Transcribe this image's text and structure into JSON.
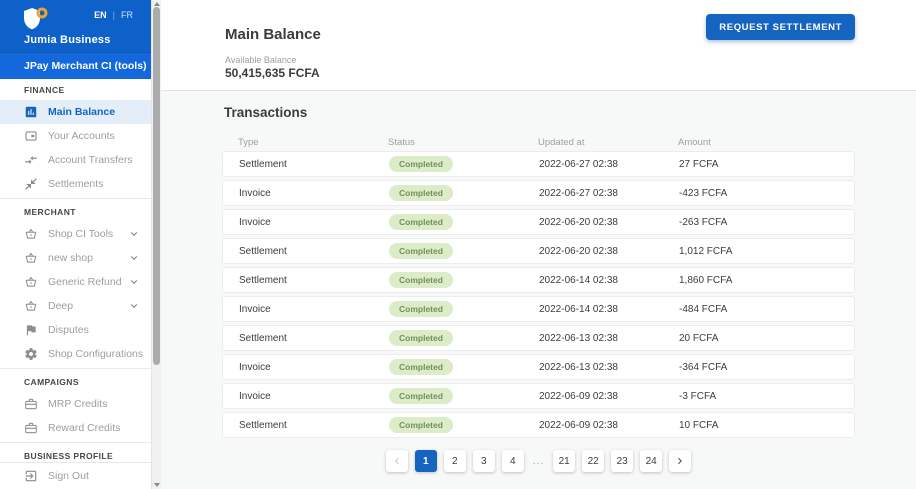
{
  "colors": {
    "accent": "#1565c0",
    "sidebar_header_blue": "#0d61c9",
    "sidebar_app_row_blue": "#1368dc",
    "selected_item_bg": "#e4eef9",
    "content_bg": "#f7f8f8",
    "badge_bg": "#dcebc8",
    "badge_text": "#71905a",
    "logo_ring_orange": "#f0a22e"
  },
  "icons": {
    "logo": "shield-with-orange-ring",
    "main_balance": "bar-chart-square",
    "your_accounts": "wallet",
    "account_transfers": "compare-arrows",
    "settlements": "collapse-diagonal-arrows",
    "merchant_item": "shopping-basket",
    "disputes": "flag",
    "shop_configurations": "gear",
    "campaigns_item": "briefcase",
    "sign_out": "exit-to-app",
    "expand": "chevron-down",
    "pager_prev": "chevron-left",
    "pager_next": "chevron-right"
  },
  "sidebar": {
    "brand": "Jumia Business",
    "lang_en": "EN",
    "lang_sep": "|",
    "lang_fr": "FR",
    "app_name": "JPay Merchant CI (tools)",
    "sign_out": "Sign Out",
    "sections": [
      {
        "title": "FINANCE",
        "items": [
          {
            "label": "Main Balance",
            "selected": true
          },
          {
            "label": "Your Accounts"
          },
          {
            "label": "Account Transfers"
          },
          {
            "label": "Settlements"
          }
        ]
      },
      {
        "title": "MERCHANT",
        "items": [
          {
            "label": "Shop CI Tools",
            "expandable": true
          },
          {
            "label": "new shop",
            "expandable": true
          },
          {
            "label": "Generic Refund",
            "expandable": true
          },
          {
            "label": "Deep",
            "expandable": true
          },
          {
            "label": "Disputes"
          },
          {
            "label": "Shop Configurations"
          }
        ]
      },
      {
        "title": "CAMPAIGNS",
        "items": [
          {
            "label": "MRP Credits"
          },
          {
            "label": "Reward Credits"
          }
        ]
      },
      {
        "title": "BUSINESS PROFILE",
        "items": []
      }
    ]
  },
  "header": {
    "title": "Main Balance",
    "request_button": "REQUEST SETTLEMENT"
  },
  "balance": {
    "label": "Available Balance",
    "value": "50,415,635 FCFA"
  },
  "transactions": {
    "title": "Transactions",
    "columns": [
      "Type",
      "Status",
      "Updated at",
      "Amount"
    ],
    "rows": [
      {
        "type": "Settlement",
        "status": "Completed",
        "updated_at": "2022-06-27 02:38",
        "amount": "27 FCFA"
      },
      {
        "type": "Invoice",
        "status": "Completed",
        "updated_at": "2022-06-27 02:38",
        "amount": "-423 FCFA"
      },
      {
        "type": "Invoice",
        "status": "Completed",
        "updated_at": "2022-06-20 02:38",
        "amount": "-263 FCFA"
      },
      {
        "type": "Settlement",
        "status": "Completed",
        "updated_at": "2022-06-20 02:38",
        "amount": "1,012 FCFA"
      },
      {
        "type": "Settlement",
        "status": "Completed",
        "updated_at": "2022-06-14 02:38",
        "amount": "1,860 FCFA"
      },
      {
        "type": "Invoice",
        "status": "Completed",
        "updated_at": "2022-06-14 02:38",
        "amount": "-484 FCFA"
      },
      {
        "type": "Settlement",
        "status": "Completed",
        "updated_at": "2022-06-13 02:38",
        "amount": "20 FCFA"
      },
      {
        "type": "Invoice",
        "status": "Completed",
        "updated_at": "2022-06-13 02:38",
        "amount": "-364 FCFA"
      },
      {
        "type": "Invoice",
        "status": "Completed",
        "updated_at": "2022-06-09 02:38",
        "amount": "-3 FCFA"
      },
      {
        "type": "Settlement",
        "status": "Completed",
        "updated_at": "2022-06-09 02:38",
        "amount": "10 FCFA"
      }
    ]
  },
  "pagination": {
    "active_page": "1",
    "pages": [
      "1",
      "2",
      "3",
      "4"
    ],
    "ellipsis": "...",
    "pages_end": [
      "21",
      "22",
      "23",
      "24"
    ]
  }
}
